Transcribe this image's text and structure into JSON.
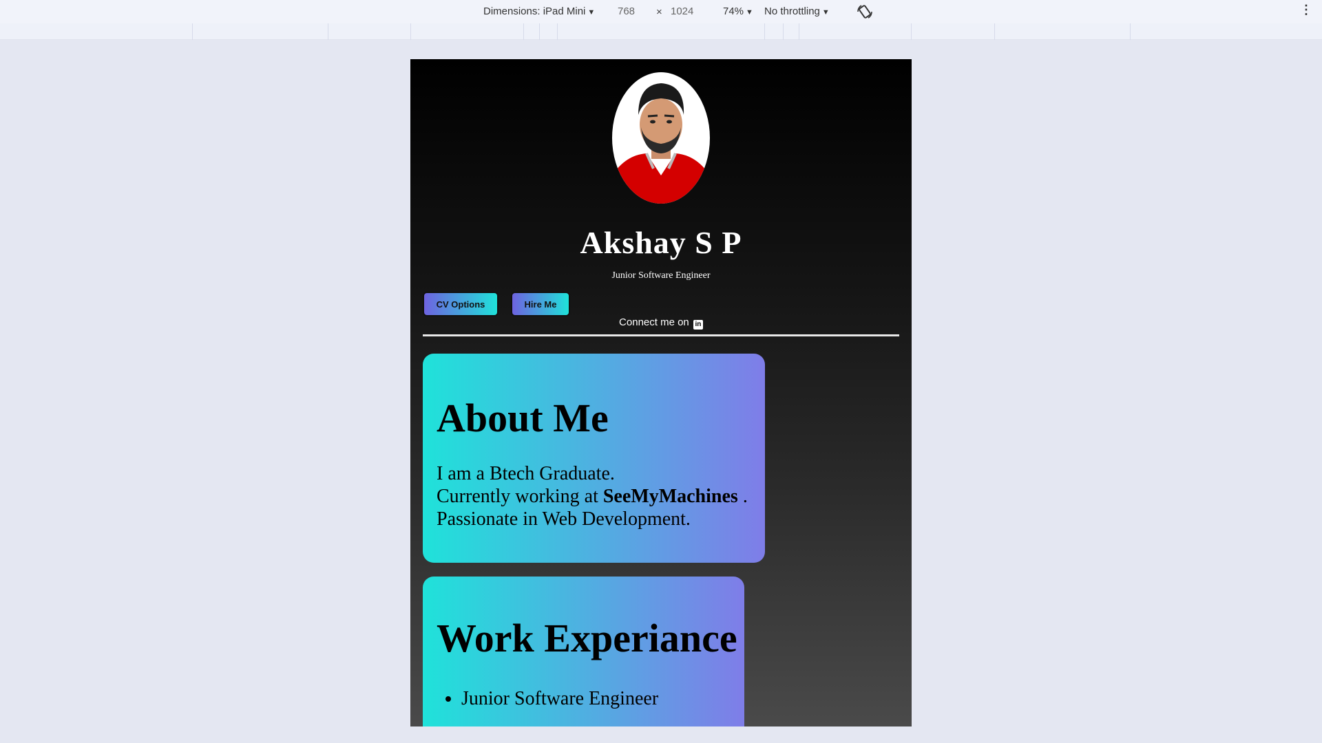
{
  "devtools": {
    "dimensions_label": "Dimensions: iPad Mini",
    "width": "768",
    "times": "×",
    "height": "1024",
    "zoom": "74%",
    "throttling": "No throttling",
    "rotate_icon": "rotate-icon",
    "more_icon": "more-vert-icon"
  },
  "profile": {
    "avatar_icon": "profile-photo",
    "name": "Akshay S P",
    "role": "Junior Software Engineer"
  },
  "buttons": {
    "cv_options": "CV Options",
    "hire_me": "Hire Me"
  },
  "connect": {
    "text": "Connect me on",
    "icon": "linkedin-icon",
    "icon_glyph": "in"
  },
  "about": {
    "title": "About Me",
    "line1": "I am a Btech Graduate.",
    "line2_prefix": "Currently working at ",
    "company": "SeeMyMachines",
    "line2_suffix": " .",
    "line3": "Passionate in Web Development."
  },
  "work": {
    "title": "Work Experiance",
    "items": [
      "Junior Software Engineer"
    ]
  },
  "colors": {
    "gradient_start": "#1fe2da",
    "gradient_end": "#7f7de8",
    "button_gradient_start": "#6e63e0",
    "shirt": "#d40000"
  }
}
